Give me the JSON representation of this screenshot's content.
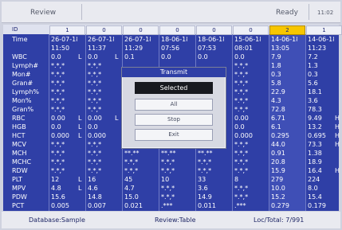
{
  "topbar": {
    "title": "Review",
    "status": "Ready",
    "clock": "11:02"
  },
  "table": {
    "id_label": "ID",
    "ids": [
      "1",
      "0",
      "0",
      "0",
      "0",
      "0",
      "2",
      "1"
    ],
    "rows": [
      {
        "label": "Time",
        "values": [
          "26-07-18",
          "26-07-18",
          "26-07-18",
          "18-06-18",
          "18-06-18",
          "15-06-18",
          "14-06-18",
          "14-06-18"
        ]
      },
      {
        "label": "",
        "values": [
          "11:50",
          "11:37",
          "11:29",
          "07:56",
          "07:53",
          "08:01",
          "13:05",
          "11:23"
        ]
      },
      {
        "label": "WBC",
        "values": [
          "0.0",
          "0.0",
          "0.1",
          "0.0",
          "0.0",
          "0.0",
          "7.9",
          "7.2"
        ],
        "flags": [
          "L",
          "L",
          "",
          "",
          "",
          "",
          "",
          ""
        ]
      },
      {
        "label": "Lymph#",
        "values": [
          "*.*,*",
          "*.*,*",
          "",
          "",
          "",
          "*.*,*",
          "1.8",
          "1.3"
        ]
      },
      {
        "label": "Mon#",
        "values": [
          "*.*,*",
          "*.*,*",
          "",
          "",
          "",
          "*.*,*",
          "0.3",
          "0.3"
        ]
      },
      {
        "label": "Gran#",
        "values": [
          "*.*,*",
          "*.*,*",
          "",
          "",
          "",
          "*.*,*",
          "5.8",
          "5.6"
        ]
      },
      {
        "label": "Lymph%",
        "values": [
          "*.*,*",
          "*.*,*",
          "",
          "",
          "",
          "*.*,*",
          "22.9",
          "18.1"
        ]
      },
      {
        "label": "Mon%",
        "values": [
          "*.*,*",
          "*.*,*",
          "",
          "",
          "",
          "*.*,*",
          "4.3",
          "3.6"
        ]
      },
      {
        "label": "Gran%",
        "values": [
          "*.*,*",
          "*.*,*",
          "",
          "",
          "",
          "*.*,*",
          "72.8",
          "78.3"
        ]
      },
      {
        "label": "RBC",
        "values": [
          "0.00",
          "0.00",
          "",
          "",
          "",
          "0.00",
          "6.71",
          "9.49"
        ],
        "flags": [
          "L",
          "L",
          "",
          "",
          "",
          "",
          "",
          "H"
        ]
      },
      {
        "label": "HGB",
        "values": [
          "0.0",
          "0.0",
          "",
          "",
          "",
          "0.0",
          "6.1",
          "13.2"
        ],
        "flags": [
          "L",
          "",
          "",
          "",
          "",
          "",
          "",
          "H"
        ]
      },
      {
        "label": "HCT",
        "values": [
          "0.000",
          "0.000",
          "",
          "",
          "",
          "0.000",
          "0.295",
          "0.695"
        ],
        "flags": [
          "L",
          "",
          "",
          "",
          "",
          "",
          "",
          "H"
        ]
      },
      {
        "label": "MCV",
        "values": [
          "*.*,*",
          "*.*,*",
          "",
          "",
          "",
          "*.*,*",
          "44.0",
          "73.3"
        ],
        "flags": [
          "",
          "",
          "",
          "",
          "",
          "",
          "",
          "H"
        ]
      },
      {
        "label": "MCH",
        "values": [
          "*.*,*",
          "*.*,*",
          "**.**",
          "**.**",
          "**.**",
          "*.*,*",
          "0.91",
          "1.38"
        ]
      },
      {
        "label": "MCHC",
        "values": [
          "*.*,*",
          "*.*,*",
          "*.*,*",
          "*.*,*",
          "*.*,*",
          "*.*,*",
          "20.8",
          "18.9"
        ]
      },
      {
        "label": "RDW",
        "values": [
          "*.*,*",
          "*.*,*",
          "*.*,*",
          "*.*,*",
          "*.*,*",
          "*.*,*",
          "15.9",
          "16.4"
        ],
        "flags": [
          "",
          "",
          "",
          "",
          "",
          "",
          "",
          "H"
        ]
      },
      {
        "label": "PLT",
        "values": [
          "12",
          "16",
          "45",
          "10",
          "33",
          "8",
          "279",
          "224"
        ],
        "flags": [
          "L",
          "",
          "",
          "",
          "",
          "",
          "",
          ""
        ]
      },
      {
        "label": "MPV",
        "values": [
          "4.8",
          "4.6",
          "4.7",
          "*.*,*",
          "3.6",
          "*.*,*",
          "10.0",
          "8.0"
        ],
        "flags": [
          "L",
          "",
          "",
          "",
          "",
          "",
          "",
          ""
        ]
      },
      {
        "label": "PDW",
        "values": [
          "15.6",
          "14.8",
          "15.0",
          "*.*,*",
          "14.9",
          "*.*,*",
          "15.2",
          "15.4"
        ]
      },
      {
        "label": "PCT",
        "values": [
          "0.005",
          "0.007",
          "0.021",
          ".***",
          "0.011",
          ".***",
          "0.279",
          "0.179"
        ]
      }
    ]
  },
  "dialog": {
    "title": "Transmit",
    "buttons": [
      "Selected",
      "All",
      "Stop",
      "Exit"
    ]
  },
  "footer": {
    "database": "Database:Sample",
    "review": "Review:Table",
    "loc": "Loc/Total: 7/991"
  }
}
